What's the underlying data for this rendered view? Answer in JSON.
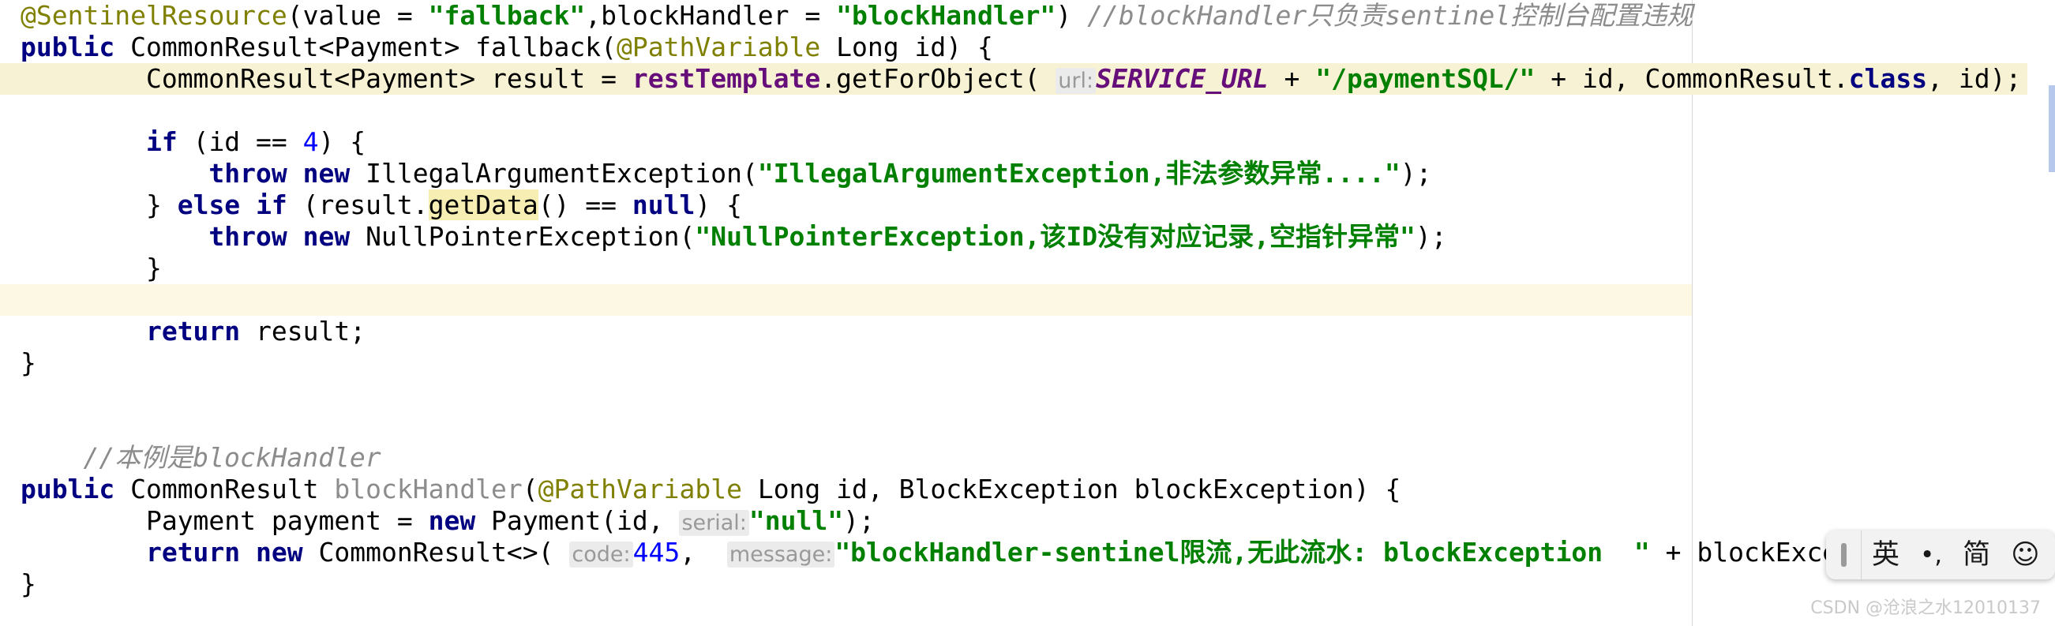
{
  "editor": {
    "language": "java",
    "caret_line_index": 7,
    "colors": {
      "background": "#ffffff",
      "keyword": "#000080",
      "annotation": "#808000",
      "string": "#008000",
      "number": "#0000ff",
      "comment": "#8c8c8c",
      "static_field": "#660e7a",
      "current_line": "#fdf8e4",
      "search_highlight": "#f7eeb4",
      "scrollbar_thumb": "#b6c8ec",
      "hint_background": "#ebebeb",
      "hint_text": "#999999"
    },
    "lines": [
      {
        "id": "line-1",
        "tokens": [
          {
            "t": "@SentinelResource",
            "c": "ann"
          },
          {
            "t": "(value = ",
            "c": "plain"
          },
          {
            "t": "\"fallback\"",
            "c": "str"
          },
          {
            "t": ",blockHandler = ",
            "c": "plain"
          },
          {
            "t": "\"blockHandler\"",
            "c": "str"
          },
          {
            "t": ") ",
            "c": "plain"
          },
          {
            "t": "//blockHandler只负责sentinel控制台配置违规",
            "c": "cmt"
          }
        ]
      },
      {
        "id": "line-2",
        "tokens": [
          {
            "t": "public",
            "c": "kw"
          },
          {
            "t": " CommonResult<Payment> fallback(",
            "c": "plain"
          },
          {
            "t": "@PathVariable",
            "c": "ann"
          },
          {
            "t": " Long id) {",
            "c": "plain"
          }
        ]
      },
      {
        "id": "line-3",
        "highlight": "line",
        "indent": 2,
        "tokens": [
          {
            "t": "CommonResult<Payment> result = ",
            "c": "plain"
          },
          {
            "t": "restTemplate",
            "c": "mfield"
          },
          {
            "t": ".getForObject( ",
            "c": "plain"
          },
          {
            "t": "url:",
            "c": "hint"
          },
          {
            "t": "SERVICE_URL",
            "c": "fld"
          },
          {
            "t": " + ",
            "c": "plain"
          },
          {
            "t": "\"/paymentSQL/\"",
            "c": "str"
          },
          {
            "t": " + id, CommonResult.",
            "c": "plain"
          },
          {
            "t": "class",
            "c": "kw"
          },
          {
            "t": ", id);",
            "c": "plain"
          }
        ]
      },
      {
        "id": "line-4",
        "tokens": []
      },
      {
        "id": "line-5",
        "indent": 2,
        "tokens": [
          {
            "t": "if",
            "c": "kw"
          },
          {
            "t": " (id == ",
            "c": "plain"
          },
          {
            "t": "4",
            "c": "num"
          },
          {
            "t": ") {",
            "c": "plain"
          }
        ]
      },
      {
        "id": "line-6",
        "indent": 3,
        "tokens": [
          {
            "t": "throw",
            "c": "kw"
          },
          {
            "t": " ",
            "c": "plain"
          },
          {
            "t": "new",
            "c": "kw"
          },
          {
            "t": " IllegalArgumentException(",
            "c": "plain"
          },
          {
            "t": "\"IllegalArgumentException,非法参数异常....\"",
            "c": "str"
          },
          {
            "t": ");",
            "c": "plain"
          }
        ]
      },
      {
        "id": "line-7",
        "indent": 2,
        "tokens": [
          {
            "t": "} ",
            "c": "plain"
          },
          {
            "t": "else",
            "c": "kw"
          },
          {
            "t": " ",
            "c": "plain"
          },
          {
            "t": "if",
            "c": "kw"
          },
          {
            "t": " (result.",
            "c": "plain"
          },
          {
            "t": "getData",
            "c": "plain",
            "hl": "soft"
          },
          {
            "t": "() == ",
            "c": "plain"
          },
          {
            "t": "null",
            "c": "kw"
          },
          {
            "t": ") {",
            "c": "plain"
          }
        ]
      },
      {
        "id": "line-8",
        "indent": 3,
        "tokens": [
          {
            "t": "throw",
            "c": "kw"
          },
          {
            "t": " ",
            "c": "plain"
          },
          {
            "t": "new",
            "c": "kw"
          },
          {
            "t": " NullPointerException(",
            "c": "plain"
          },
          {
            "t": "\"NullPointerException,该ID没有对应记录,空指针异常\"",
            "c": "str"
          },
          {
            "t": ");",
            "c": "plain"
          }
        ]
      },
      {
        "id": "line-9",
        "indent": 2,
        "tokens": [
          {
            "t": "}",
            "c": "plain"
          }
        ]
      },
      {
        "id": "line-10",
        "tokens": [],
        "caret": true
      },
      {
        "id": "line-11",
        "indent": 2,
        "tokens": [
          {
            "t": "return",
            "c": "kw"
          },
          {
            "t": " result;",
            "c": "plain"
          }
        ]
      },
      {
        "id": "line-12",
        "tokens": [
          {
            "t": "}",
            "c": "plain"
          }
        ]
      },
      {
        "id": "line-13",
        "tokens": []
      },
      {
        "id": "line-14",
        "tokens": []
      },
      {
        "id": "line-15",
        "indent": 1,
        "tokens": [
          {
            "t": "//本例是blockHandler",
            "c": "cmt"
          }
        ]
      },
      {
        "id": "line-16",
        "tokens": [
          {
            "t": "public",
            "c": "kw"
          },
          {
            "t": " CommonResult ",
            "c": "plain"
          },
          {
            "t": "blockHandler",
            "c": "declmeth"
          },
          {
            "t": "(",
            "c": "plain"
          },
          {
            "t": "@PathVariable",
            "c": "ann"
          },
          {
            "t": " Long id, BlockException blockException) {",
            "c": "plain"
          }
        ]
      },
      {
        "id": "line-17",
        "indent": 2,
        "tokens": [
          {
            "t": "Payment payment = ",
            "c": "plain"
          },
          {
            "t": "new",
            "c": "kw"
          },
          {
            "t": " Payment(id, ",
            "c": "plain"
          },
          {
            "t": "serial:",
            "c": "hint"
          },
          {
            "t": "\"null\"",
            "c": "str"
          },
          {
            "t": ");",
            "c": "plain"
          }
        ]
      },
      {
        "id": "line-18",
        "indent": 2,
        "tokens": [
          {
            "t": "return",
            "c": "kw"
          },
          {
            "t": " ",
            "c": "plain"
          },
          {
            "t": "new",
            "c": "kw"
          },
          {
            "t": " CommonResult<>( ",
            "c": "plain"
          },
          {
            "t": "code:",
            "c": "hint"
          },
          {
            "t": "445",
            "c": "num"
          },
          {
            "t": ",  ",
            "c": "plain"
          },
          {
            "t": "message:",
            "c": "hint"
          },
          {
            "t": "\"blockHandler-sentinel限流,无此流水: blockException  \"",
            "c": "str"
          },
          {
            "t": " + blockException.getMe",
            "c": "plain"
          }
        ]
      },
      {
        "id": "line-19",
        "tokens": [
          {
            "t": "}",
            "c": "plain"
          }
        ]
      }
    ]
  },
  "ime_bar": {
    "handle_label": "drag-handle",
    "items": [
      {
        "id": "ime-language",
        "label": "英",
        "name": "ime-language-toggle"
      },
      {
        "id": "ime-punctuation",
        "label": "•,",
        "name": "ime-punctuation-toggle"
      },
      {
        "id": "ime-charset",
        "label": "简",
        "name": "ime-simplified-toggle"
      },
      {
        "id": "ime-emoji",
        "label": "☺",
        "name": "ime-emoji-button"
      }
    ]
  },
  "watermark": {
    "text": "CSDN @沧浪之水12010137"
  }
}
